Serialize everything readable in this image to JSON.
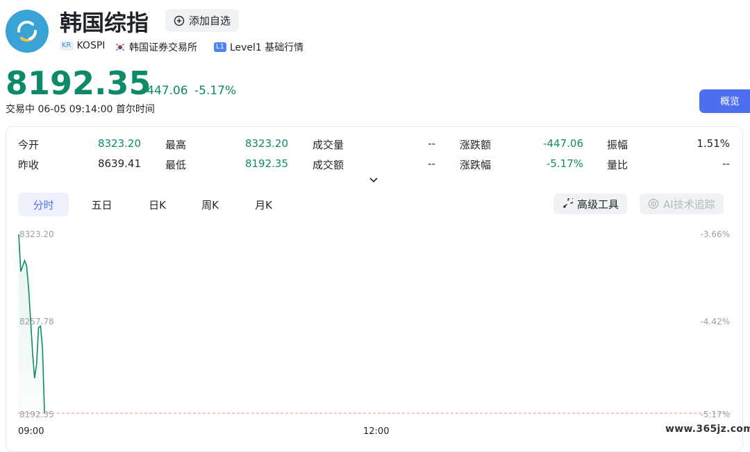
{
  "header": {
    "title": "韩国综指",
    "watch_label": "添加自选",
    "country_tag": "KR",
    "code": "KOSPI",
    "exchange": "韩国证券交易所",
    "level_tag": "L1",
    "level_label": "Level1 基础行情"
  },
  "quote": {
    "price": "8192.35",
    "change": "-447.06",
    "change_pct": "-5.17%",
    "status": "交易中",
    "datetime": "06-05 09:14:00",
    "timezone": "首尔时间",
    "overview_label": "概览"
  },
  "stats": {
    "open_label": "今开",
    "open": "8323.20",
    "high_label": "最高",
    "high": "8323.20",
    "volume_label": "成交量",
    "volume": "--",
    "chg_amt_label": "涨跌额",
    "chg_amt": "-447.06",
    "amplitude_label": "振幅",
    "amplitude": "1.51%",
    "prev_close_label": "昨收",
    "prev_close": "8639.41",
    "low_label": "最低",
    "low": "8192.35",
    "turnover_label": "成交额",
    "turnover": "--",
    "chg_pct_label": "涨跌幅",
    "chg_pct": "-5.17%",
    "vol_ratio_label": "量比",
    "vol_ratio": "--"
  },
  "tabs": [
    "分时",
    "五日",
    "日K",
    "周K",
    "月K"
  ],
  "tools": {
    "advanced_label": "高级工具",
    "ai_label": "AI技术追踪"
  },
  "colors": {
    "up_down_green": "#0d8a6a",
    "accent": "#4e6ef2"
  },
  "chart_data": {
    "type": "line",
    "y_left_ticks": [
      "8323.20",
      "8257.78",
      "8192.35"
    ],
    "y_right_ticks": [
      "-3.66%",
      "-4.42%",
      "-5.17%"
    ],
    "x_ticks": [
      "09:00",
      "12:00"
    ],
    "ylim": [
      8192.35,
      8323.2
    ],
    "reference_line": 8192.35,
    "series": [
      {
        "values": [
          8323.2,
          8296,
          8300,
          8304,
          8300,
          8283,
          8260,
          8236,
          8218,
          8228,
          8255,
          8256,
          8240,
          8192.35
        ]
      }
    ]
  },
  "watermark": "www.365jz.com"
}
